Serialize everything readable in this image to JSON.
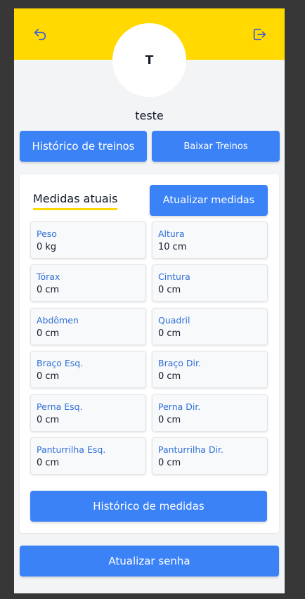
{
  "header": {
    "back_icon": "undo-arrow-icon",
    "logout_icon": "logout-icon",
    "accent_color": "#ffd900"
  },
  "profile": {
    "avatar_initial": "T",
    "username": "teste"
  },
  "actions": {
    "historico_treinos": "Histórico de treinos",
    "baixar_treinos": "Baixar Treinos"
  },
  "medidas": {
    "title": "Medidas atuais",
    "update_button": "Atualizar medidas",
    "items": [
      {
        "label": "Peso",
        "value": "0 kg"
      },
      {
        "label": "Altura",
        "value": "10 cm"
      },
      {
        "label": "Tórax",
        "value": "0 cm"
      },
      {
        "label": "Cintura",
        "value": "0 cm"
      },
      {
        "label": "Abdômen",
        "value": "0 cm"
      },
      {
        "label": "Quadril",
        "value": "0 cm"
      },
      {
        "label": "Braço Esq.",
        "value": "0 cm"
      },
      {
        "label": "Braço Dir.",
        "value": "0 cm"
      },
      {
        "label": "Perna Esq.",
        "value": "0 cm"
      },
      {
        "label": "Perna Dir.",
        "value": "0 cm"
      },
      {
        "label": "Panturrilha Esq.",
        "value": "0 cm"
      },
      {
        "label": "Panturrilha Dir.",
        "value": "0 cm"
      }
    ],
    "history_button": "Histórico de medidas"
  },
  "footer": {
    "atualizar_senha": "Atualizar senha"
  },
  "colors": {
    "primary": "#3b82f6",
    "label_blue": "#2f6fd6",
    "background": "#f3f4f6"
  }
}
